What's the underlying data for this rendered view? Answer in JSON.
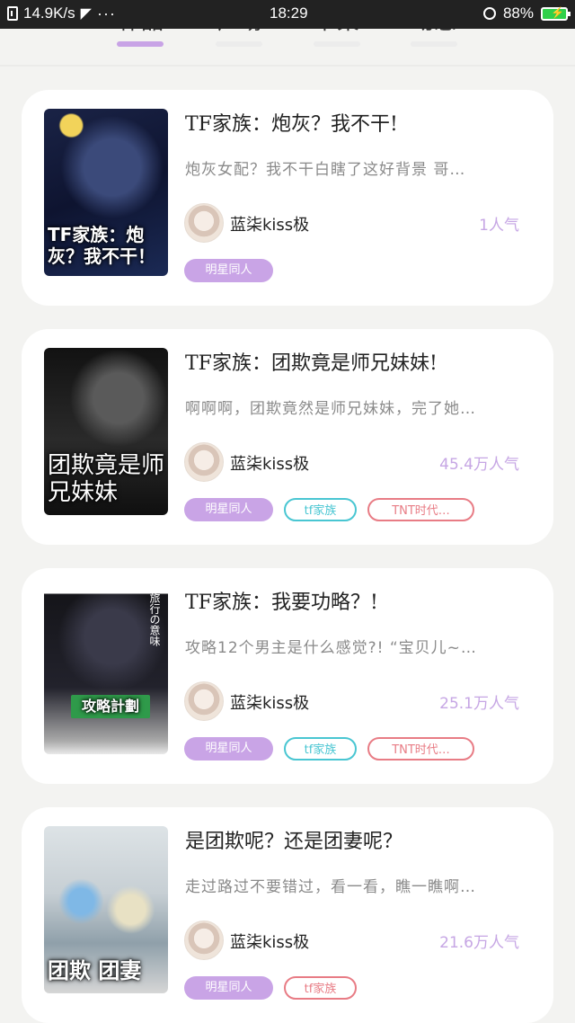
{
  "status_bar": {
    "speed": "14.9K/s",
    "time": "18:29",
    "battery": "88%"
  },
  "tabs": [
    {
      "label": "作品",
      "active": true
    },
    {
      "label": "广场",
      "active": false
    },
    {
      "label": "书架",
      "active": false
    },
    {
      "label": "动态",
      "active": false
    }
  ],
  "colors": {
    "accent": "#c8a3e6",
    "tag_cyan": "#49c6d2",
    "tag_red": "#e87c85",
    "popularity": "#c6a6e4"
  },
  "books": [
    {
      "title": "TF家族：炮灰？我不干!",
      "description": "炮灰女配？我不干白瞎了这好背景 哥…",
      "cover_text": "TF家族：炮灰？我不干！",
      "author": "蓝柒kiss极",
      "popularity": "1人气",
      "tags": [
        {
          "label": "明星同人",
          "style": "purple"
        }
      ]
    },
    {
      "title": "TF家族：团欺竟是师兄妹妹!",
      "description": "啊啊啊，团欺竟然是师兄妹妹，完了她…",
      "cover_text": "团欺竟是师兄妹妹",
      "author": "蓝柒kiss极",
      "popularity": "45.4万人气",
      "tags": [
        {
          "label": "明星同人",
          "style": "purple"
        },
        {
          "label": "tf家族",
          "style": "cyan"
        },
        {
          "label": "TNT时代…",
          "style": "red"
        }
      ]
    },
    {
      "title": "TF家族：我要功略？!",
      "description": "攻略12个男主是什么感觉?! “宝贝儿~…",
      "cover_text": "攻略計劃",
      "cover_side": "旅行の意味",
      "author": "蓝柒kiss极",
      "popularity": "25.1万人气",
      "tags": [
        {
          "label": "明星同人",
          "style": "purple"
        },
        {
          "label": "tf家族",
          "style": "cyan"
        },
        {
          "label": "TNT时代…",
          "style": "red"
        }
      ]
    },
    {
      "title": "是团欺呢？还是团妻呢？",
      "description": "走过路过不要错过，看一看，瞧一瞧啊…",
      "cover_text": "团欺 团妻",
      "author": "蓝柒kiss极",
      "popularity": "21.6万人气",
      "tags": [
        {
          "label": "明星同人",
          "style": "purple"
        },
        {
          "label": "tf家族",
          "style": "red"
        }
      ]
    }
  ]
}
